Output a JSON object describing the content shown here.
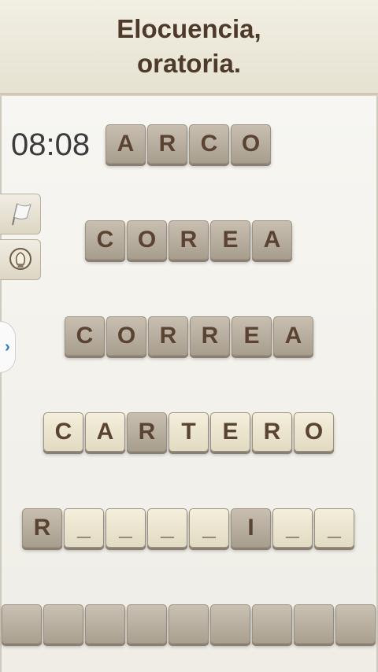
{
  "header": {
    "title": "Elocuencia,\noratoria."
  },
  "timer": "08:08",
  "controls": {
    "flag_icon": "flag-icon",
    "hint_icon": "lightbulb-icon",
    "expand_icon": "chevron-right-icon",
    "expand_glyph": "›"
  },
  "rows": [
    {
      "tiles": [
        {
          "letter": "A",
          "state": "used"
        },
        {
          "letter": "R",
          "state": "used"
        },
        {
          "letter": "C",
          "state": "used"
        },
        {
          "letter": "O",
          "state": "used"
        }
      ]
    },
    {
      "tiles": [
        {
          "letter": "C",
          "state": "used"
        },
        {
          "letter": "O",
          "state": "used"
        },
        {
          "letter": "R",
          "state": "used"
        },
        {
          "letter": "E",
          "state": "used"
        },
        {
          "letter": "A",
          "state": "used"
        }
      ]
    },
    {
      "tiles": [
        {
          "letter": "C",
          "state": "used"
        },
        {
          "letter": "O",
          "state": "used"
        },
        {
          "letter": "R",
          "state": "used"
        },
        {
          "letter": "R",
          "state": "used"
        },
        {
          "letter": "E",
          "state": "used"
        },
        {
          "letter": "A",
          "state": "used"
        }
      ]
    },
    {
      "tiles": [
        {
          "letter": "C",
          "state": "fresh"
        },
        {
          "letter": "A",
          "state": "fresh"
        },
        {
          "letter": "R",
          "state": "used"
        },
        {
          "letter": "T",
          "state": "fresh"
        },
        {
          "letter": "E",
          "state": "fresh"
        },
        {
          "letter": "R",
          "state": "fresh"
        },
        {
          "letter": "O",
          "state": "fresh"
        }
      ]
    },
    {
      "tiles": [
        {
          "letter": "R",
          "state": "used"
        },
        {
          "letter": "_",
          "state": "blank"
        },
        {
          "letter": "_",
          "state": "blank"
        },
        {
          "letter": "_",
          "state": "blank"
        },
        {
          "letter": "_",
          "state": "blank"
        },
        {
          "letter": "I",
          "state": "used"
        },
        {
          "letter": "_",
          "state": "blank"
        },
        {
          "letter": "_",
          "state": "blank"
        }
      ]
    },
    {
      "tiles": [
        {
          "letter": "",
          "state": "empty"
        },
        {
          "letter": "",
          "state": "empty"
        },
        {
          "letter": "",
          "state": "empty"
        },
        {
          "letter": "",
          "state": "empty"
        },
        {
          "letter": "",
          "state": "empty"
        },
        {
          "letter": "",
          "state": "empty"
        },
        {
          "letter": "",
          "state": "empty"
        },
        {
          "letter": "",
          "state": "empty"
        },
        {
          "letter": "",
          "state": "empty"
        }
      ]
    }
  ]
}
